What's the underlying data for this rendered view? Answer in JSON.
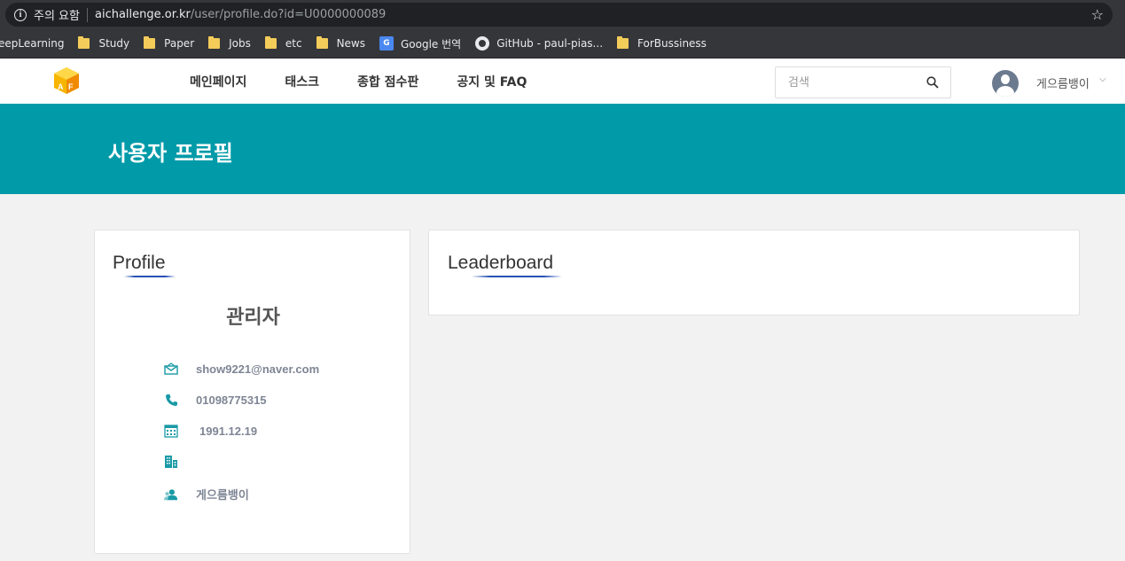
{
  "browser": {
    "security_warning": "주의 요함",
    "url_host": "aichallenge.or.kr",
    "url_path": "/user/profile.do?id=U0000000089",
    "bookmarks": [
      {
        "label": "eepLearning",
        "icon": "folder-icon"
      },
      {
        "label": "Study",
        "icon": "folder-icon"
      },
      {
        "label": "Paper",
        "icon": "folder-icon"
      },
      {
        "label": "Jobs",
        "icon": "folder-icon"
      },
      {
        "label": "etc",
        "icon": "folder-icon"
      },
      {
        "label": "News",
        "icon": "folder-icon"
      },
      {
        "label": "Google 번역",
        "icon": "google-translate-icon"
      },
      {
        "label": "GitHub - paul-pias...",
        "icon": "github-icon"
      },
      {
        "label": "ForBussiness",
        "icon": "folder-icon"
      }
    ]
  },
  "header": {
    "nav": [
      "메인페이지",
      "태스크",
      "종합 점수판",
      "공지 및 FAQ"
    ],
    "search_placeholder": "검색",
    "user_name": "게으름뱅이"
  },
  "banner": {
    "title": "사용자 프로필"
  },
  "profile": {
    "title": "Profile",
    "name": "관리자",
    "email": "show9221@naver.com",
    "phone": "01098775315",
    "birthdate": "1991.12.19",
    "organization": "",
    "nickname": "게으름뱅이"
  },
  "leaderboard": {
    "title": "Leaderboard"
  },
  "colors": {
    "banner": "#009aa8",
    "accent": "#2851b4",
    "icon": "#1a9aa6"
  }
}
